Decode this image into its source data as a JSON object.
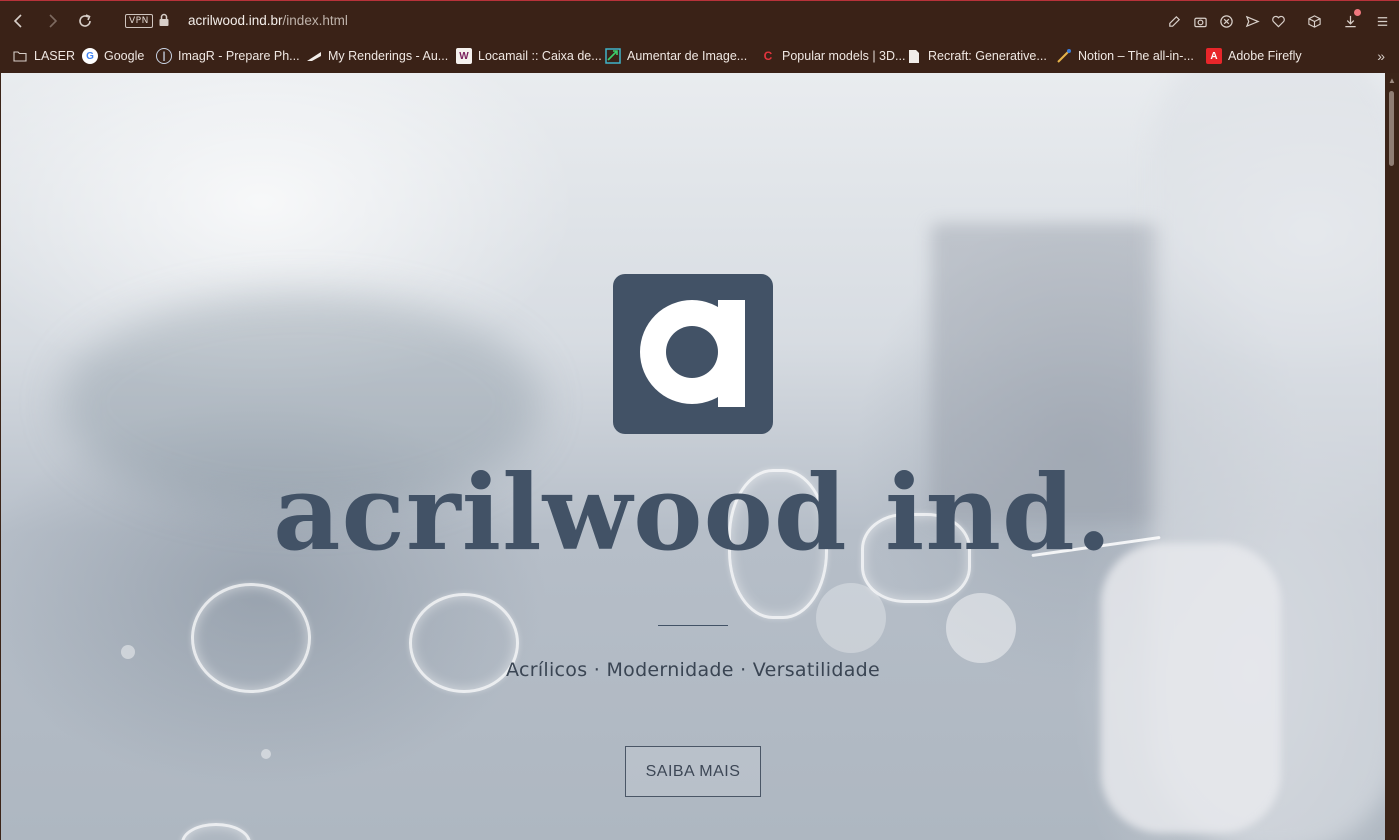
{
  "browser": {
    "vpn_label": "VPN",
    "url_host": "acrilwood.ind.br",
    "url_path": "/index.html",
    "nav_icons": [
      "back-icon",
      "forward-icon",
      "reload-icon"
    ],
    "toolbar_icons": [
      "edit-icon",
      "camera-icon",
      "close-circle-icon",
      "send-icon",
      "heart-icon",
      "cube-icon",
      "download-icon",
      "menu-icon"
    ]
  },
  "bookmarks": [
    {
      "label": "LASER",
      "icon": "folder-icon"
    },
    {
      "label": "Google",
      "icon": "google-icon"
    },
    {
      "label": "ImagR - Prepare Ph...",
      "icon": "imagr-icon"
    },
    {
      "label": "My Renderings - Au...",
      "icon": "renderings-icon"
    },
    {
      "label": "Locamail :: Caixa de...",
      "icon": "locamail-icon"
    },
    {
      "label": "Aumentar de Image...",
      "icon": "upscale-icon"
    },
    {
      "label": "Popular models | 3D...",
      "icon": "c-icon"
    },
    {
      "label": "Recraft: Generative...",
      "icon": "document-icon"
    },
    {
      "label": "Notion – The all-in-...",
      "icon": "notion-icon"
    },
    {
      "label": "Adobe Firefly",
      "icon": "adobe-icon"
    }
  ],
  "hero": {
    "logo_letter": "a",
    "brand": "acrilwood ind.",
    "tagline": "Acrílicos · Modernidade · Versatilidade",
    "cta_label": "SAIBA MAIS"
  },
  "colors": {
    "chrome": "#3a2217",
    "brand_slate": "#425266",
    "text_dark": "#3a4553"
  }
}
